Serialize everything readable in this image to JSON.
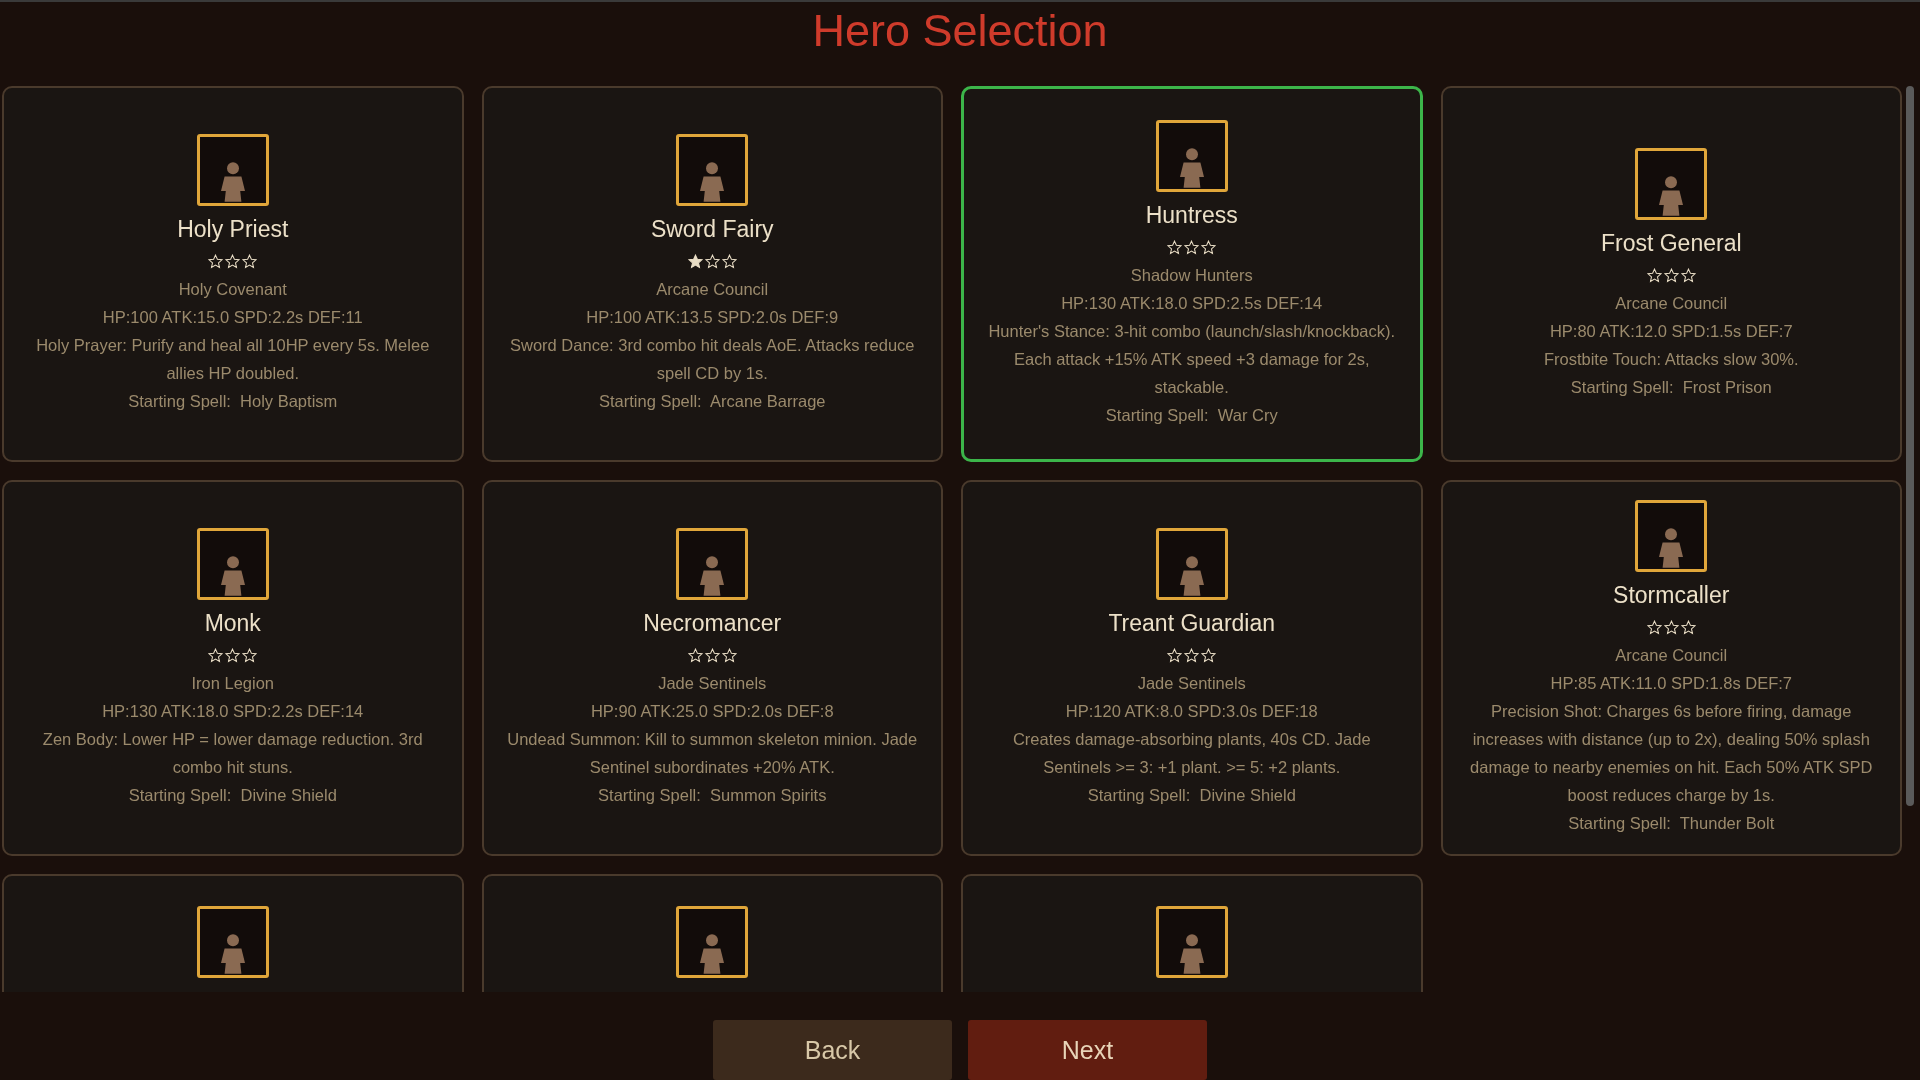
{
  "title": "Hero Selection",
  "heroes": [
    {
      "kind": "full",
      "selected": false,
      "name": "Holy Priest",
      "stars": 0,
      "faction": "Holy Covenant",
      "stats": "HP:100 ATK:15.0 SPD:2.2s DEF:11",
      "ability": [
        "Holy Prayer: Purify and heal all 10HP every 5s. Melee allies HP doubled."
      ],
      "spell": "Starting Spell:  Holy Baptism"
    },
    {
      "kind": "full",
      "selected": false,
      "name": "Sword Fairy",
      "stars": 1,
      "faction": "Arcane Council",
      "stats": "HP:100 ATK:13.5 SPD:2.0s DEF:9",
      "ability": [
        "Sword Dance: 3rd combo hit deals AoE. Attacks reduce spell CD by 1s."
      ],
      "spell": "Starting Spell:  Arcane Barrage"
    },
    {
      "kind": "full",
      "selected": true,
      "name": "Huntress",
      "stars": 0,
      "faction": "Shadow Hunters",
      "stats": "HP:130 ATK:18.0 SPD:2.5s DEF:14",
      "ability": [
        "Hunter's Stance: 3-hit combo (launch/slash/knockback).",
        "Each attack +15% ATK speed +3 damage for 2s, stackable."
      ],
      "spell": "Starting Spell:  War Cry"
    },
    {
      "kind": "full",
      "selected": false,
      "name": "Frost General",
      "stars": 0,
      "faction": "Arcane Council",
      "stats": "HP:80 ATK:12.0 SPD:1.5s DEF:7",
      "ability": [
        "Frostbite Touch: Attacks slow 30%."
      ],
      "spell": "Starting Spell:  Frost Prison"
    },
    {
      "kind": "full",
      "selected": false,
      "name": "Monk",
      "stars": 0,
      "faction": "Iron Legion",
      "stats": "HP:130 ATK:18.0 SPD:2.2s DEF:14",
      "ability": [
        "Zen Body: Lower HP = lower damage reduction. 3rd combo hit stuns."
      ],
      "spell": "Starting Spell:  Divine Shield"
    },
    {
      "kind": "full",
      "selected": false,
      "name": "Necromancer",
      "stars": 0,
      "faction": "Jade Sentinels",
      "stats": "HP:90 ATK:25.0 SPD:2.0s DEF:8",
      "ability": [
        "Undead Summon: Kill to summon skeleton minion. Jade Sentinel subordinates +20% ATK."
      ],
      "spell": "Starting Spell:  Summon Spirits"
    },
    {
      "kind": "full",
      "selected": false,
      "name": "Treant Guardian",
      "stars": 0,
      "faction": "Jade Sentinels",
      "stats": "HP:120 ATK:8.0 SPD:3.0s DEF:18",
      "ability": [
        "Creates damage-absorbing plants, 40s CD. Jade Sentinels >= 3: +1 plant. >= 5: +2 plants."
      ],
      "spell": "Starting Spell:  Divine Shield"
    },
    {
      "kind": "full",
      "selected": false,
      "name": "Stormcaller",
      "stars": 0,
      "faction": "Arcane Council",
      "stats": "HP:85 ATK:11.0 SPD:1.8s DEF:7",
      "ability": [
        "Precision Shot: Charges 6s before firing, damage increases with distance (up to 2x), dealing 50% splash damage to nearby enemies on hit. Each 50% ATK SPD boost reduces charge by 1s."
      ],
      "spell": "Starting Spell:  Thunder Bolt"
    },
    {
      "kind": "cut_off",
      "selected": false
    },
    {
      "kind": "cut_off",
      "selected": false
    },
    {
      "kind": "cut_off",
      "selected": false
    }
  ],
  "buttons": [
    {
      "label": "Back",
      "kind": "secondary"
    },
    {
      "label": "Next",
      "kind": "primary"
    }
  ]
}
